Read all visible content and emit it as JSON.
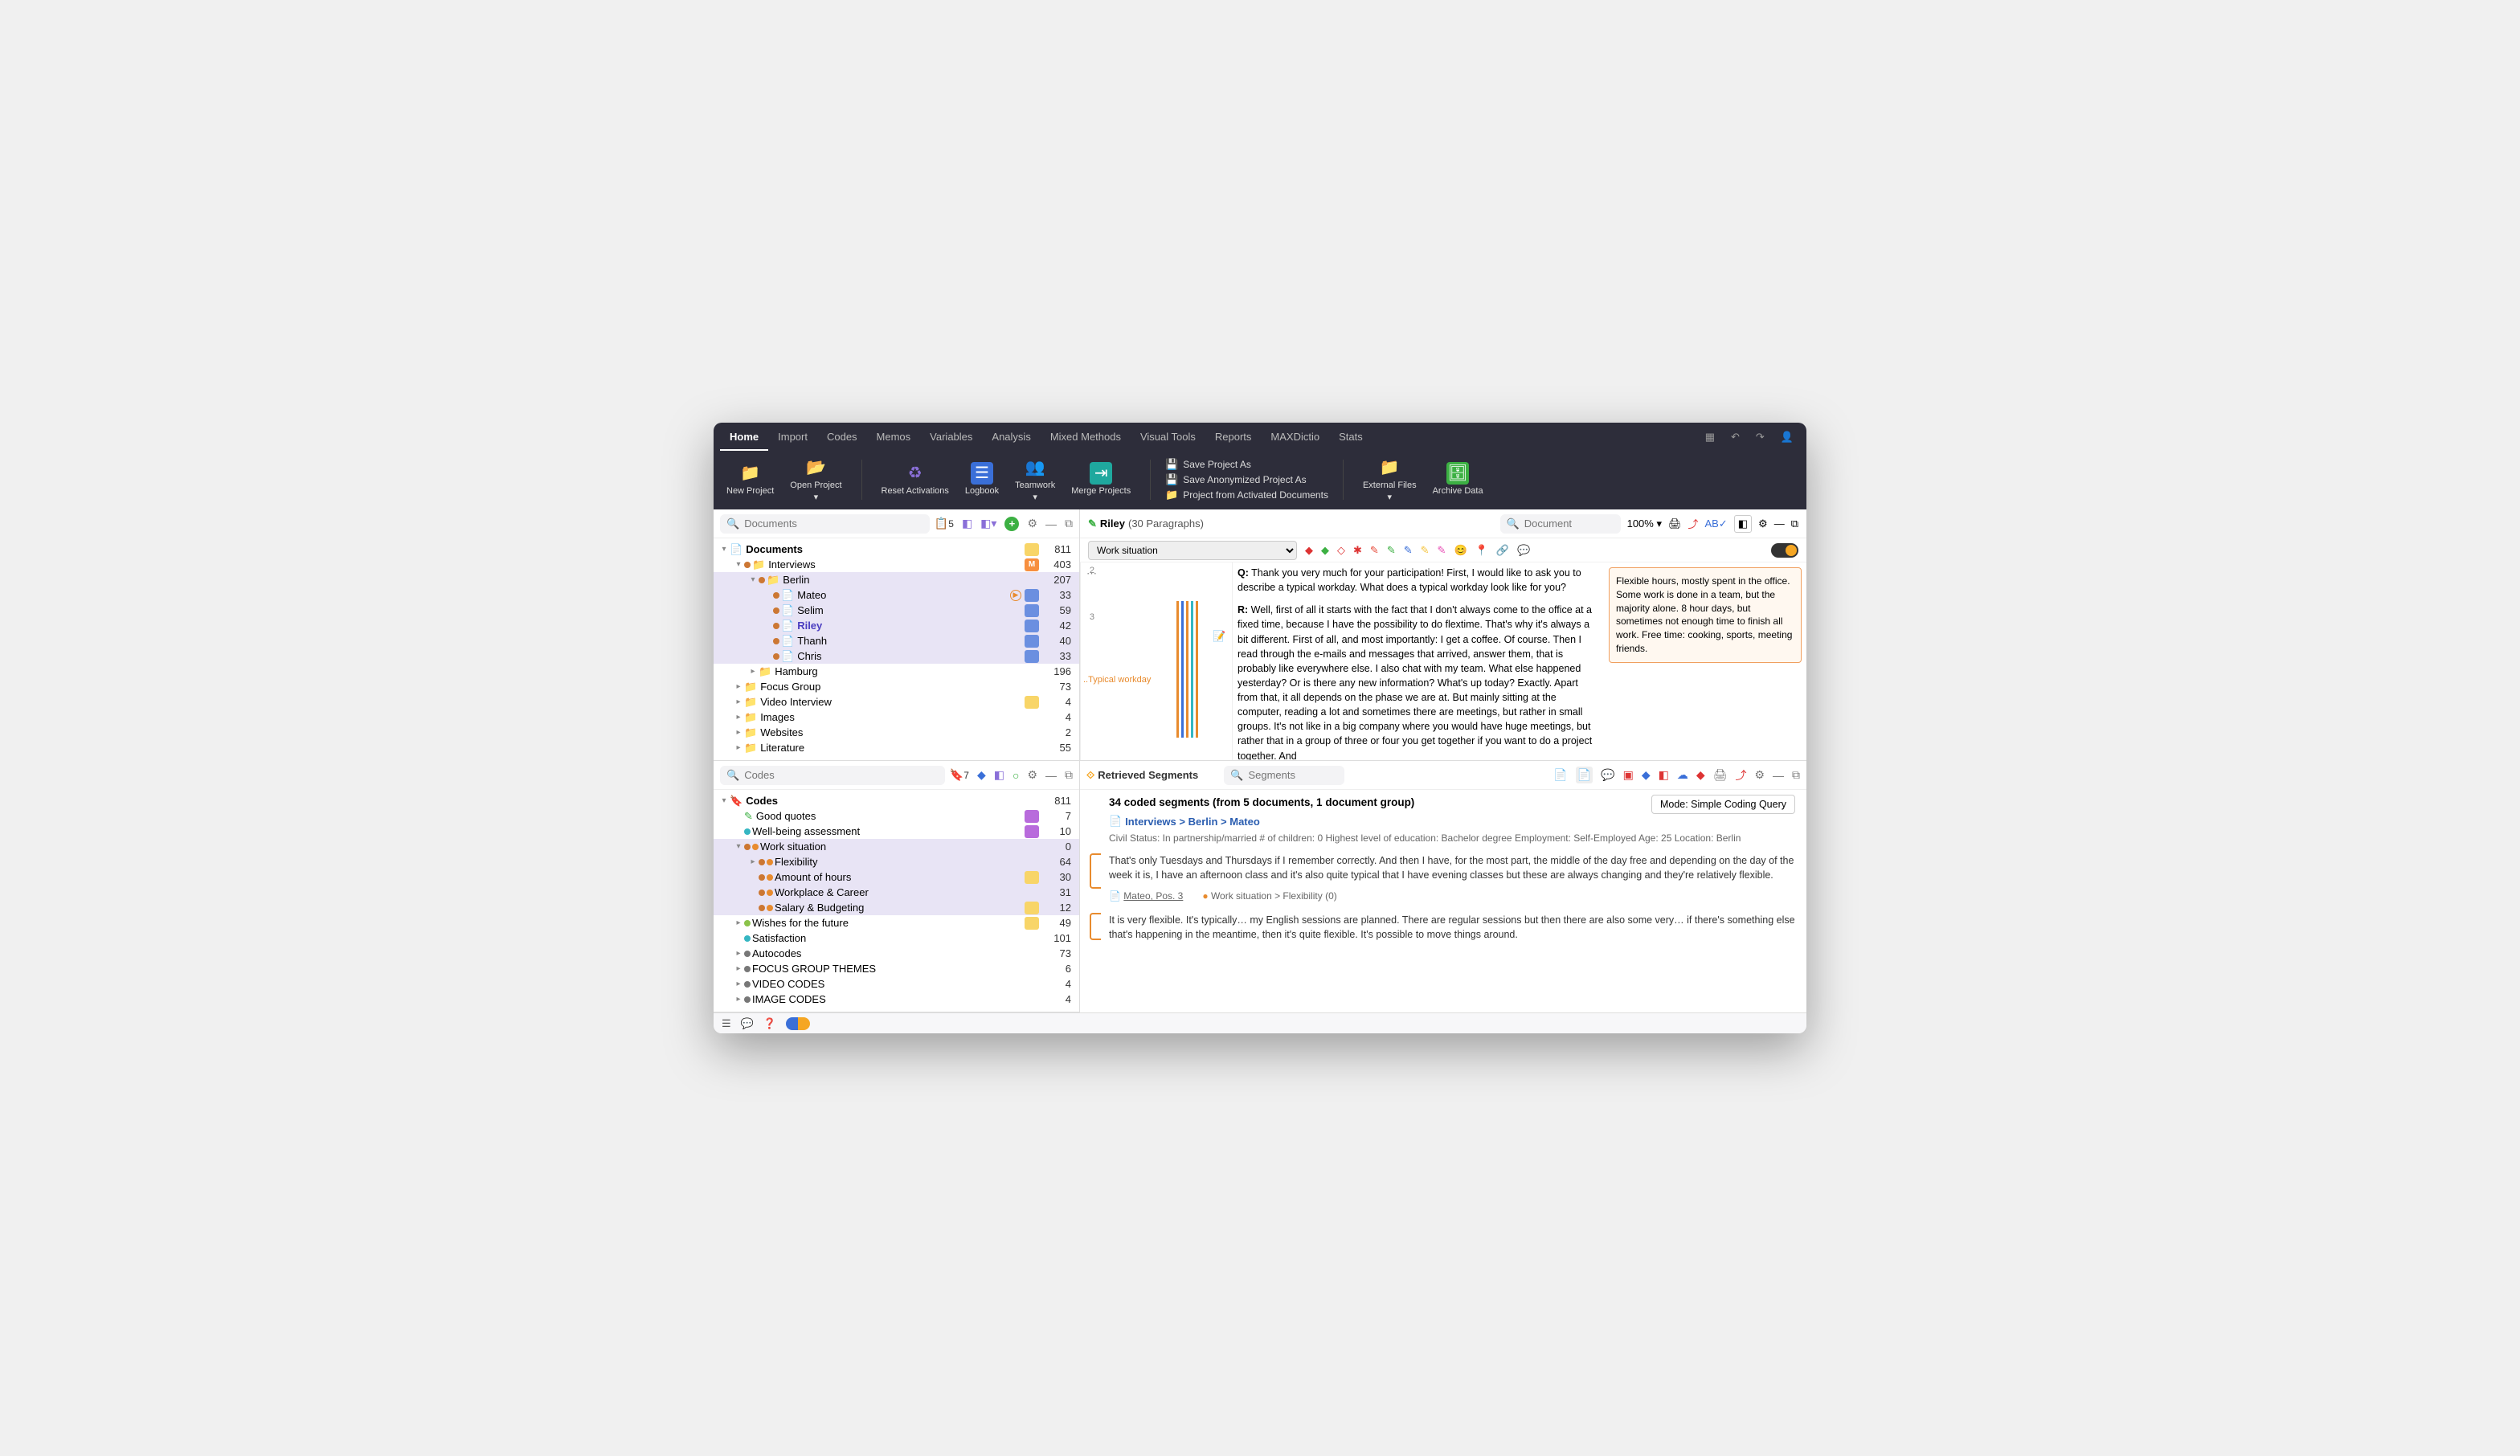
{
  "menu": {
    "tabs": [
      "Home",
      "Import",
      "Codes",
      "Memos",
      "Variables",
      "Analysis",
      "Mixed Methods",
      "Visual Tools",
      "Reports",
      "MAXDictio",
      "Stats"
    ],
    "active": 0
  },
  "ribbon": {
    "new_project": "New\nProject",
    "open_project": "Open\nProject",
    "reset_activations": "Reset\nActivations",
    "logbook": "Logbook",
    "teamwork": "Teamwork",
    "merge_projects": "Merge\nProjects",
    "save_as": "Save Project As",
    "save_anon": "Save Anonymized Project As",
    "from_activated": "Project from Activated Documents",
    "external_files": "External\nFiles",
    "archive_data": "Archive\nData"
  },
  "docs_panel": {
    "search_placeholder": "Documents",
    "activated_count": "5",
    "rows": [
      {
        "indent": 0,
        "caret": "▾",
        "icon": "📄",
        "color": "#f5a623",
        "label": "Documents",
        "count": "811",
        "root": true,
        "badge": "#f8d568"
      },
      {
        "indent": 1,
        "caret": "▾",
        "dot": "#c73",
        "icon": "📁",
        "iconcolor": "#3a6fd8",
        "label": "Interviews",
        "count": "403",
        "badge": "#f78f3f",
        "badgetext": "M"
      },
      {
        "indent": 2,
        "caret": "▾",
        "dot": "#c73",
        "icon": "📁",
        "iconcolor": "#3a6fd8",
        "label": "Berlin",
        "count": "207",
        "sel": true
      },
      {
        "indent": 3,
        "dot": "#c73",
        "icon": "📄",
        "iconcolor": "#f5a623",
        "label": "Mateo",
        "count": "33",
        "sel": true,
        "badge": "#6b8fe0",
        "play": true
      },
      {
        "indent": 3,
        "dot": "#c73",
        "icon": "📄",
        "iconcolor": "#f5a623",
        "label": "Selim",
        "count": "59",
        "sel": true,
        "badge": "#6b8fe0"
      },
      {
        "indent": 3,
        "dot": "#c73",
        "icon": "📄",
        "iconcolor": "#f5a623",
        "label": "Riley",
        "count": "42",
        "sel": true,
        "badge": "#6b8fe0",
        "bold": true
      },
      {
        "indent": 3,
        "dot": "#c73",
        "icon": "📄",
        "iconcolor": "#f5a623",
        "label": "Thanh",
        "count": "40",
        "sel": true,
        "badge": "#6b8fe0"
      },
      {
        "indent": 3,
        "dot": "#c73",
        "icon": "📄",
        "iconcolor": "#f5a623",
        "label": "Chris",
        "count": "33",
        "sel": true,
        "badge": "#6b8fe0"
      },
      {
        "indent": 2,
        "caret": "▸",
        "icon": "📁",
        "iconcolor": "#3a6fd8",
        "label": "Hamburg",
        "count": "196"
      },
      {
        "indent": 1,
        "caret": "▸",
        "icon": "📁",
        "iconcolor": "#3a6fd8",
        "label": "Focus Group",
        "count": "73"
      },
      {
        "indent": 1,
        "caret": "▸",
        "icon": "📁",
        "iconcolor": "#3a6fd8",
        "label": "Video Interview",
        "count": "4",
        "badge": "#f8d568"
      },
      {
        "indent": 1,
        "caret": "▸",
        "icon": "📁",
        "iconcolor": "#3a6fd8",
        "label": "Images",
        "count": "4"
      },
      {
        "indent": 1,
        "caret": "▸",
        "icon": "📁",
        "iconcolor": "#3a6fd8",
        "label": "Websites",
        "count": "2"
      },
      {
        "indent": 1,
        "caret": "▸",
        "icon": "📁",
        "iconcolor": "#3a6fd8",
        "label": "Literature",
        "count": "55"
      }
    ]
  },
  "codes_panel": {
    "search_placeholder": "Codes",
    "activated_count": "7",
    "rows": [
      {
        "indent": 0,
        "caret": "▾",
        "icon": "🔖",
        "iconcolor": "#f5a623",
        "label": "Codes",
        "count": "811",
        "root": true
      },
      {
        "indent": 1,
        "icon": "✎",
        "iconcolor": "#3cb043",
        "label": "Good quotes",
        "count": "7",
        "badge": "#b86bdc"
      },
      {
        "indent": 1,
        "dot": "#35b6c2",
        "label": "Well-being assessment",
        "count": "10",
        "badge": "#b86bdc"
      },
      {
        "indent": 1,
        "caret": "▾",
        "dot": "#c73",
        "cdot": "#e88b2e",
        "label": "Work situation",
        "count": "0",
        "sel": true
      },
      {
        "indent": 2,
        "caret": "▸",
        "dot": "#c73",
        "cdot": "#e88b2e",
        "label": "Flexibility",
        "count": "64",
        "sel": true
      },
      {
        "indent": 2,
        "dot": "#c73",
        "cdot": "#e88b2e",
        "label": "Amount of hours",
        "count": "30",
        "sel": true,
        "badge": "#f8d568"
      },
      {
        "indent": 2,
        "dot": "#c73",
        "cdot": "#e88b2e",
        "label": "Workplace & Career",
        "count": "31",
        "sel": true
      },
      {
        "indent": 2,
        "dot": "#c73",
        "cdot": "#e88b2e",
        "label": "Salary & Budgeting",
        "count": "12",
        "sel": true,
        "badge": "#f8d568"
      },
      {
        "indent": 1,
        "caret": "▸",
        "cdot": "#8bc34a",
        "label": "Wishes for the future",
        "count": "49",
        "badge": "#f8d568"
      },
      {
        "indent": 1,
        "cdot": "#35b6c2",
        "label": "Satisfaction",
        "count": "101"
      },
      {
        "indent": 1,
        "caret": "▸",
        "cdot": "#777",
        "label": "Autocodes",
        "count": "73"
      },
      {
        "indent": 1,
        "caret": "▸",
        "cdot": "#777",
        "label": "FOCUS GROUP THEMES",
        "count": "6"
      },
      {
        "indent": 1,
        "caret": "▸",
        "cdot": "#777",
        "label": "VIDEO CODES",
        "count": "4"
      },
      {
        "indent": 1,
        "caret": "▸",
        "cdot": "#777",
        "label": "IMAGE CODES",
        "count": "4"
      }
    ]
  },
  "browser": {
    "doc_title": "Riley",
    "doc_sub": "(30 Paragraphs)",
    "search_placeholder": "Document",
    "zoom": "100%",
    "combo_value": "Work situation",
    "para_q_num": "2",
    "para_r_num": "3",
    "q_text": "Q: Thank you very much for your participation! First, I would like to ask you to describe a typical workday. What does a typical workday look like for you?",
    "r_prefix": "R:",
    "r_text": " Well, first of all it starts with the fact that I don't always come to the office at a fixed time, because I have the possibility to do flextime. That's why it's always a bit different. First of all, and most importantly: I get a coffee. Of course. Then I read through the e-mails and messages that arrived, answer them, that is probably like everywhere else. I also chat with my team. What else happened yesterday? Or is there any new information? What's up today? Exactly. Apart from that, it all depends on the phase we are at. But mainly sitting at the computer, reading a lot and sometimes there are meetings, but rather in small groups. It's not like in a big company where you would have huge meetings, but rather that in a group of three or four you get together if you want to do a project together. And",
    "coding_label": "..Typical workday",
    "memo_text": "Flexible hours, mostly spent in the office. Some work is done in a team, but the majority alone. 8 hour days, but sometimes not enough time to finish all work. Free time: cooking, sports, meeting friends."
  },
  "retrieved": {
    "title": "Retrieved Segments",
    "search_placeholder": "Segments",
    "summary": "34 coded segments (from 5 documents, 1 document group)",
    "crumb": "Interviews > Berlin > Mateo",
    "mode": "Mode: Simple Coding Query",
    "meta": "Civil Status: In partnership/married   # of children: 0   Highest level of education: Bachelor degree   Employment: Self-Employed   Age: 25   Location: Berlin",
    "seg1": "That's only Tuesdays and Thursdays if I remember correctly. And then I have, for the most part, the middle of the day free and depending on the day of the week it is, I have an afternoon class and it's also quite typical that I have evening classes but these are always changing and they're relatively flexible.",
    "seg1_pos": "Mateo, Pos. 3",
    "seg1_code": "Work situation > Flexibility (0)",
    "seg2": "It is very flexible. It's typically… my English sessions are planned. There are regular sessions but then there are also some very… if there's something else that's happening in the meantime, then it's quite flexible. It's possible to move things around."
  }
}
